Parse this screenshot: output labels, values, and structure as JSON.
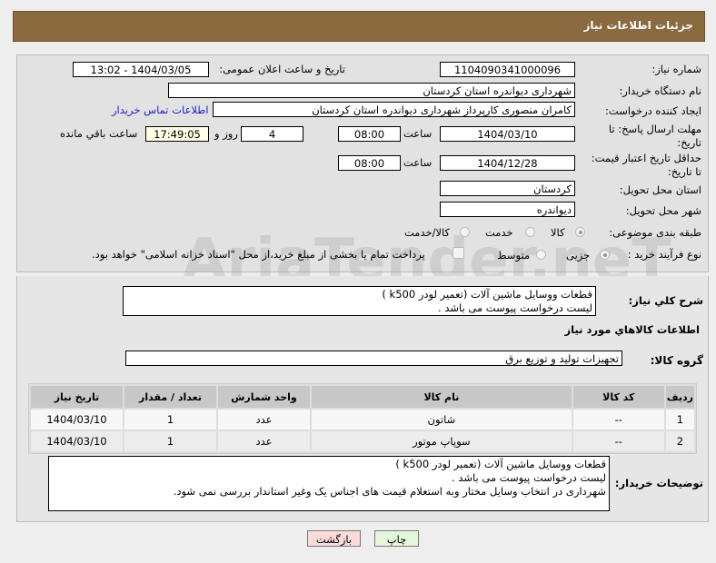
{
  "header": {
    "title": "جزئیات اطلاعات نیاز"
  },
  "form": {
    "need_number_label": "شماره نیاز:",
    "need_number": "1104090341000096",
    "announce_label": "تاریخ و ساعت اعلان عمومی:",
    "announce_value": "1404/03/05 - 13:02",
    "buyer_org_label": "نام دستگاه خریدار:",
    "buyer_org": "شهرداری دیواندره استان کردستان",
    "creator_label": "ایجاد کننده درخواست:",
    "creator": "کامران منصوری کارپرداز شهرداری دیواندره استان کردستان",
    "contact_link": "اطلاعات تماس خریدار",
    "deadline_label": "مهلت ارسال پاسخ: تا تاریخ:",
    "deadline_date": "1404/03/10",
    "time_label": "ساعت",
    "deadline_time": "08:00",
    "days": "4",
    "days_label": "روز و",
    "remaining": "17:49:05",
    "remaining_label": "ساعت باقي مانده",
    "validity_label": "حداقل تاریخ اعتبار قیمت: تا تاریخ:",
    "validity_date": "1404/12/28",
    "validity_time": "08:00",
    "province_label": "استان محل تحویل:",
    "province": "کردستان",
    "city_label": "شهر محل تحویل:",
    "city": "دیواندره",
    "category_label": "طبقه بندی موضوعی:",
    "category_options": [
      "کالا",
      "خدمت",
      "کالا/خدمت"
    ],
    "process_label": "نوع فرآیند خرید :",
    "process_options": [
      "جزیی",
      "متوسط"
    ],
    "treasury_text": "پرداخت تمام یا بخشی از مبلغ خرید،از محل \"اسناد خزانه اسلامی\" خواهد بود."
  },
  "description": {
    "label": "شرح کلي نیاز:",
    "text": "قطعات ووسایل ماشین آلات (تعمیر لودر k500 )\nلیست درخواست پیوست می باشد ."
  },
  "goods": {
    "section_title": "اطلاعات کالاهاي مورد نیاز",
    "group_label": "گروه کالا:",
    "group": "تجهیزات تولید و توزیع برق",
    "columns": [
      "ردیف",
      "کد کالا",
      "نام کالا",
      "واحد شمارش",
      "تعداد / مقدار",
      "تاریخ نیاز"
    ],
    "rows": [
      [
        "1",
        "--",
        "شاتون",
        "عدد",
        "1",
        "1404/03/10"
      ],
      [
        "2",
        "--",
        "سوپاپ موتور",
        "عدد",
        "1",
        "1404/03/10"
      ]
    ]
  },
  "notes": {
    "label": "توضیحات خریدار:",
    "text": "قطعات ووسایل ماشین آلات (تعمیر لودر k500 )\nلیست درخواست پیوست می باشد .\nشهرداری در انتخاب وسایل مختار وبه استعلام قیمت های اجناس یک وغیر استاندار بررسی نمی شود."
  },
  "buttons": {
    "print": "چاپ",
    "back": "بازگشت"
  },
  "watermark": "AriaTender.neT"
}
